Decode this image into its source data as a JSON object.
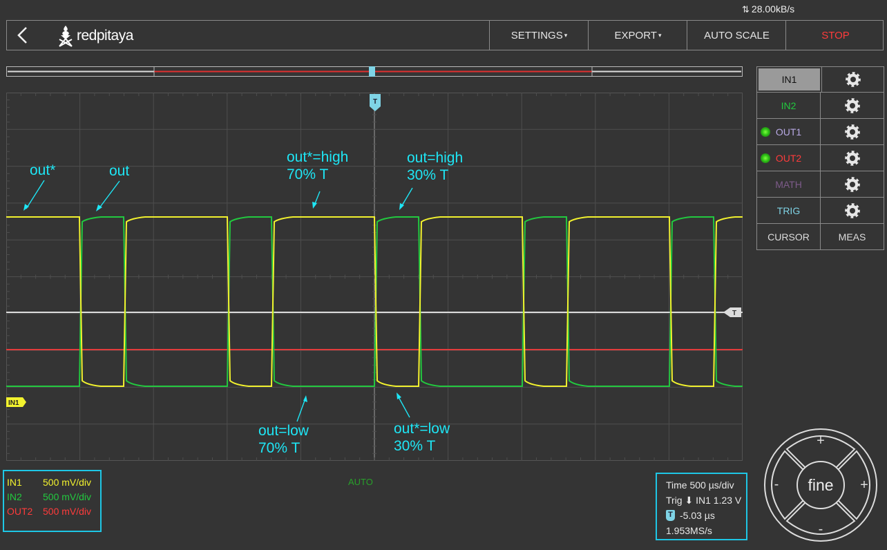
{
  "status": {
    "rate": "28.00kB/s"
  },
  "header": {
    "brand": "redpitaya",
    "settings": "SETTINGS",
    "export": "EXPORT",
    "autoscale": "AUTO SCALE",
    "stop": "STOP"
  },
  "colors": {
    "in1": "#f2f22e",
    "in2": "#22c93f",
    "out1": "#b8a9e4",
    "out2": "#ff3b3b",
    "math": "#7d5b8a",
    "trig": "#7fd4e6",
    "annotation": "#1ee6f5"
  },
  "graph": {
    "trigger_marker": "T",
    "trigger_level_marker": "T",
    "in1_marker": "IN1",
    "annotations": {
      "out_star": "out*",
      "out": "out",
      "outstar_high_1": "out*=high",
      "outstar_high_2": "70% T",
      "out_high_1": "out=high",
      "out_high_2": "30% T",
      "out_low_1": "out=low",
      "out_low_2": "70% T",
      "outstar_low_1": "out*=low",
      "outstar_low_2": "30% T"
    }
  },
  "sidebar": {
    "in1": "IN1",
    "in2": "IN2",
    "out1": "OUT1",
    "out2": "OUT2",
    "math": "MATH",
    "trig": "TRIG",
    "cursor": "CURSOR",
    "meas": "MEAS"
  },
  "scales": {
    "in1_label": "IN1",
    "in1_value": "500 mV/div",
    "in2_label": "IN2",
    "in2_value": "500 mV/div",
    "out2_label": "OUT2",
    "out2_value": "500 mV/div"
  },
  "mode": "AUTO",
  "timing": {
    "time": "Time 500 µs/div",
    "trig": "Trig ⬇ IN1 1.23 V",
    "t_badge": "T",
    "delay": "-5.03 µs",
    "rate": "1.953MS/s"
  },
  "dial": {
    "center": "fine",
    "plus": "+",
    "minus": "-"
  }
}
